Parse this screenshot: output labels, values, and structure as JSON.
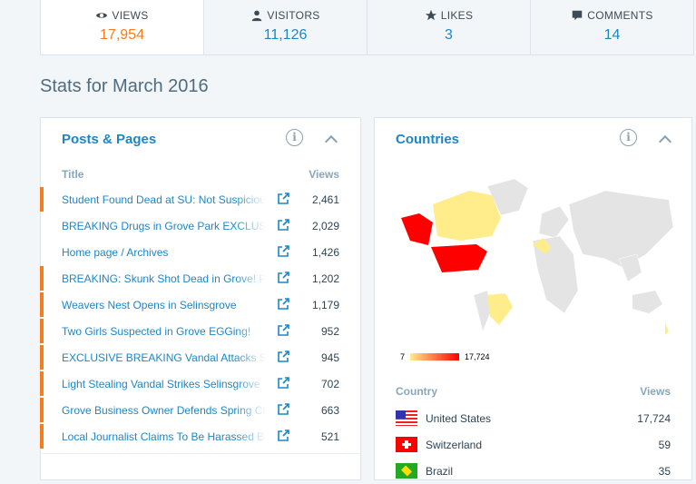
{
  "summary_tabs": [
    {
      "label": "VIEWS",
      "value": "17,954",
      "icon": "eye-icon",
      "selected": true
    },
    {
      "label": "VISITORS",
      "value": "11,126",
      "icon": "person-icon"
    },
    {
      "label": "LIKES",
      "value": "3",
      "icon": "star-icon"
    },
    {
      "label": "COMMENTS",
      "value": "14",
      "icon": "comment-icon"
    }
  ],
  "page_title": "Stats for March 2016",
  "posts": {
    "title": "Posts & Pages",
    "col_title": "Title",
    "col_views": "Views",
    "rows": [
      {
        "title": "Student Found Dead at SU: Not Suspicious",
        "views": "2,461",
        "marked": true
      },
      {
        "title": "BREAKING Drugs in Grove Park EXCLUSIVE",
        "views": "2,029",
        "marked": false
      },
      {
        "title": "Home page / Archives",
        "views": "1,426",
        "marked": false
      },
      {
        "title": "BREAKING: Skunk Shot Dead in Grove! Police",
        "views": "1,202",
        "marked": true
      },
      {
        "title": "Weavers Nest Opens in Selinsgrove",
        "views": "1,179",
        "marked": true
      },
      {
        "title": "Two Girls Suspected in Grove EGGing!",
        "views": "952",
        "marked": true
      },
      {
        "title": "EXCLUSIVE BREAKING Vandal Attacks Selinsgrove",
        "views": "945",
        "marked": true
      },
      {
        "title": "Light Stealing Vandal Strikes Selinsgrove",
        "views": "702",
        "marked": true
      },
      {
        "title": "Grove Business Owner Defends Spring Ch",
        "views": "663",
        "marked": true
      },
      {
        "title": "Local Journalist Claims To Be Harassed By",
        "views": "521",
        "marked": true
      }
    ]
  },
  "countries": {
    "title": "Countries",
    "legend_min": "7",
    "legend_max": "17,724",
    "col_country": "Country",
    "col_views": "Views",
    "rows": [
      {
        "name": "United States",
        "views": "17,724",
        "flag": "us"
      },
      {
        "name": "Switzerland",
        "views": "59",
        "flag": "ch"
      },
      {
        "name": "Brazil",
        "views": "35",
        "flag": "br"
      }
    ]
  },
  "colors": {
    "accent": "#1f86c4",
    "highlight": "#f57c1f",
    "map_high": "#ff0000",
    "map_low": "#ffec8b"
  }
}
